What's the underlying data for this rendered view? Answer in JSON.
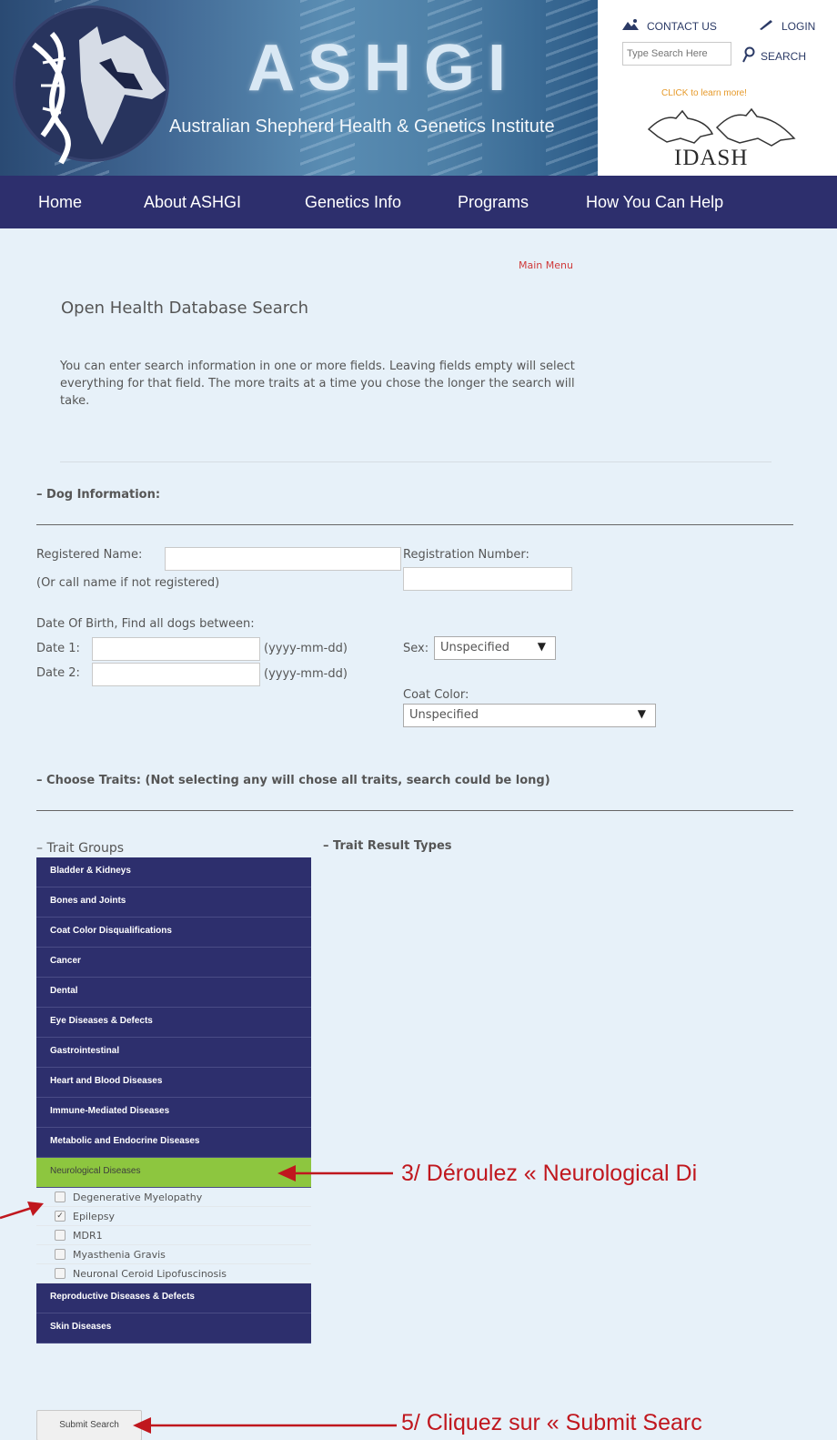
{
  "header": {
    "site_title": "ASHGI",
    "site_subtitle": "Australian Shepherd Health & Genetics Institute",
    "contact_label": "CONTACT US",
    "login_label": "LOGIN",
    "search_placeholder": "Type Search Here",
    "search_label": "SEARCH",
    "idash_cta": "CLICK to learn more!",
    "idash_text": "IDASH"
  },
  "nav": {
    "items": [
      "Home",
      "About ASHGI",
      "Genetics Info",
      "Programs",
      "How You Can Help"
    ]
  },
  "page": {
    "main_menu_link": "Main Menu",
    "title": "Open Health Database Search",
    "intro": "You can enter search information in one or more fields. Leaving fields empty will select everything for that field. The more traits at a time you chose the longer the search will take."
  },
  "dog_info": {
    "heading": "– Dog Information:",
    "registered_name_label": "Registered Name:",
    "registered_name_hint": "(Or call name if not registered)",
    "registration_number_label": "Registration Number:",
    "dob_label": "Date Of Birth, Find all dogs between:",
    "date1_label": "Date 1:",
    "date2_label": "Date 2:",
    "date_format": "(yyyy-mm-dd)",
    "sex_label": "Sex:",
    "sex_value": "Unspecified",
    "coat_color_label": "Coat Color:",
    "coat_color_value": "Unspecified"
  },
  "traits": {
    "heading": "– Choose Traits: (Not selecting any will chose all traits, search could be long)",
    "groups_heading": "– Trait Groups",
    "result_types_heading": "– Trait Result Types",
    "groups": [
      "Bladder & Kidneys",
      "Bones and Joints",
      "Coat Color Disqualifications",
      "Cancer",
      "Dental",
      "Eye Diseases & Defects",
      "Gastrointestinal",
      "Heart and Blood Diseases",
      "Immune-Mediated Diseases",
      "Metabolic and Endocrine Diseases",
      "Neurological Diseases",
      "Reproductive Diseases & Defects",
      "Skin Diseases"
    ],
    "neuro_traits": [
      {
        "label": "Degenerative Myelopathy",
        "checked": false
      },
      {
        "label": "Epilepsy",
        "checked": true
      },
      {
        "label": "MDR1",
        "checked": false
      },
      {
        "label": "Myasthenia Gravis",
        "checked": false
      },
      {
        "label": "Neuronal Ceroid Lipofuscinosis",
        "checked": false
      }
    ]
  },
  "submit_label": "Submit Search",
  "annotations": {
    "step3": "3/ Déroulez « Neurological Di",
    "step5": "5/ Cliquez sur « Submit Searc"
  },
  "colors": {
    "nav_bg": "#2d2f6d",
    "active_group": "#8dc63f",
    "annotation": "#c0171e",
    "page_bg": "#e7f1f9"
  },
  "icons": [
    "contact-mountain-icon",
    "pen-icon",
    "search-p-icon",
    "dog-logo-icon",
    "idash-dogs-icon",
    "checkbox-icon"
  ]
}
